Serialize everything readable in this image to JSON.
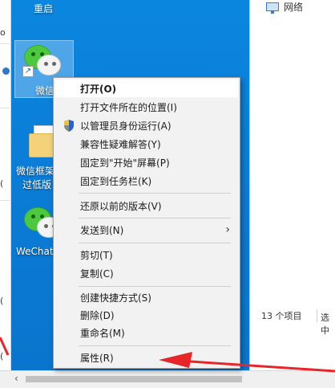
{
  "desktop": {
    "top_icon_label": "重启",
    "icons": [
      {
        "label": "微信",
        "icon": "wechat-icon"
      },
      {
        "label": "微信框架",
        "label2": "过低版",
        "icon": "folder-icon"
      },
      {
        "label": "WeChat",
        "icon": "wechat-icon"
      }
    ]
  },
  "left_strip": {
    "frag_top": "o",
    "frag_mid1": "(",
    "frag_mid2": "(",
    "frag_bottom": "(",
    "frag_bottom2": "读目"
  },
  "explorer": {
    "network_label": "网络",
    "status_count": "13 个项目",
    "status_selected": "选中"
  },
  "context_menu": {
    "items": [
      {
        "label": "打开(O)",
        "bold": true
      },
      {
        "label": "打开文件所在的位置(I)"
      },
      {
        "label": "以管理员身份运行(A)",
        "icon": "uac-shield-icon"
      },
      {
        "label": "兼容性疑难解答(Y)"
      },
      {
        "label": "固定到\"开始\"屏幕(P)"
      },
      {
        "label": "固定到任务栏(K)"
      },
      {
        "label": "还原以前的版本(V)"
      },
      {
        "label": "发送到(N)",
        "submenu": true
      },
      {
        "label": "剪切(T)"
      },
      {
        "label": "复制(C)"
      },
      {
        "label": "创建快捷方式(S)"
      },
      {
        "label": "删除(D)"
      },
      {
        "label": "重命名(M)"
      },
      {
        "label": "属性(R)"
      }
    ]
  },
  "colors": {
    "desktop_blue": "#0a7fd8",
    "menu_bg": "#f2f2f2",
    "annotation_red": "#e8262a"
  }
}
